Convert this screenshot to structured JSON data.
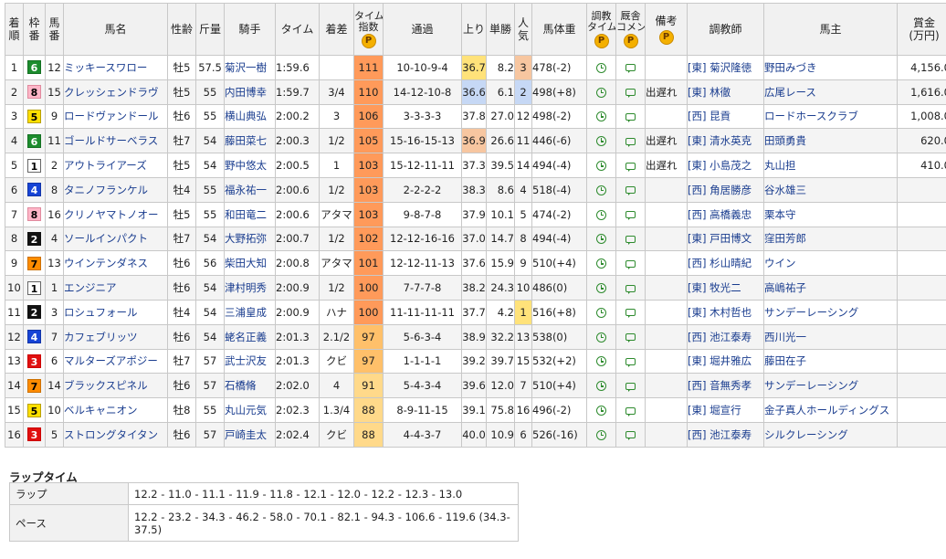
{
  "headers": {
    "rank": [
      "着",
      "順"
    ],
    "waku": [
      "枠",
      "番"
    ],
    "uma": [
      "馬",
      "番"
    ],
    "name": "馬名",
    "sexage": "性齢",
    "weight": "斤量",
    "jockey": "騎手",
    "time": "タイム",
    "margin": "着差",
    "index": [
      "タイム",
      "指数"
    ],
    "passing": "通過",
    "last3f": "上り",
    "odds": "単勝",
    "pop": [
      "人",
      "気"
    ],
    "bodyweight": "馬体重",
    "training": [
      "調教",
      "タイム"
    ],
    "stable_comment": [
      "厩舎",
      "コメント"
    ],
    "note": "備考",
    "trainer": "調教師",
    "owner": "馬主",
    "prize": [
      "賞金",
      "(万円)"
    ],
    "premium_badge": "P"
  },
  "colors": {
    "index_high": "#ff9a5a",
    "index_mid": "#ffc06a",
    "index_low": "#ffd98a",
    "last3f_1st": "#c6d8f5",
    "last3f_2nd": "#ffe27a",
    "last3f_3rd": "#f7c6a0",
    "pop_1": "#ffe27a",
    "pop_2": "#c6d8f5",
    "pop_3": "#f7c6a0",
    "icon": "#2e8b2e",
    "badge": "#f4b000"
  },
  "icons": {
    "training": "clock-icon",
    "comment": "speech-bubble-icon"
  },
  "rows": [
    {
      "rank": "1",
      "waku": "6",
      "uma": "12",
      "name": "ミッキースワロー",
      "sexage": "牡5",
      "weight": "57.5",
      "jockey": "菊沢一樹",
      "time": "1:59.6",
      "margin": "",
      "index": "111",
      "passing": "10-10-9-4",
      "last3f": "36.7",
      "odds": "8.2",
      "pop": "3",
      "bodyweight": "478(-2)",
      "note": "",
      "trainer": "[東] 菊沢隆徳",
      "owner": "野田みづき",
      "prize": "4,156.0"
    },
    {
      "rank": "2",
      "waku": "8",
      "uma": "15",
      "name": "クレッシェンドラヴ",
      "sexage": "牡5",
      "weight": "55",
      "jockey": "内田博幸",
      "time": "1:59.7",
      "margin": "3/4",
      "index": "110",
      "passing": "14-12-10-8",
      "last3f": "36.6",
      "odds": "6.1",
      "pop": "2",
      "bodyweight": "498(+8)",
      "note": "出遅れ",
      "trainer": "[東] 林徹",
      "owner": "広尾レース",
      "prize": "1,616.0"
    },
    {
      "rank": "3",
      "waku": "5",
      "uma": "9",
      "name": "ロードヴァンドール",
      "sexage": "牡6",
      "weight": "55",
      "jockey": "横山典弘",
      "time": "2:00.2",
      "margin": "3",
      "index": "106",
      "passing": "3-3-3-3",
      "last3f": "37.8",
      "odds": "27.0",
      "pop": "12",
      "bodyweight": "498(-2)",
      "note": "",
      "trainer": "[西] 昆貢",
      "owner": "ロードホースクラブ",
      "prize": "1,008.0"
    },
    {
      "rank": "4",
      "waku": "6",
      "uma": "11",
      "name": "ゴールドサーベラス",
      "sexage": "牡7",
      "weight": "54",
      "jockey": "藤田菜七",
      "time": "2:00.3",
      "margin": "1/2",
      "index": "105",
      "passing": "15-16-15-13",
      "last3f": "36.9",
      "odds": "26.6",
      "pop": "11",
      "bodyweight": "446(-6)",
      "note": "出遅れ",
      "trainer": "[東] 清水英克",
      "owner": "田頭勇貴",
      "prize": "620.0"
    },
    {
      "rank": "5",
      "waku": "1",
      "uma": "2",
      "name": "アウトライアーズ",
      "sexage": "牡5",
      "weight": "54",
      "jockey": "野中悠太",
      "time": "2:00.5",
      "margin": "1",
      "index": "103",
      "passing": "15-12-11-11",
      "last3f": "37.3",
      "odds": "39.5",
      "pop": "14",
      "bodyweight": "494(-4)",
      "note": "出遅れ",
      "trainer": "[東] 小島茂之",
      "owner": "丸山担",
      "prize": "410.0"
    },
    {
      "rank": "6",
      "waku": "4",
      "uma": "8",
      "name": "タニノフランケル",
      "sexage": "牡4",
      "weight": "55",
      "jockey": "福永祐一",
      "time": "2:00.6",
      "margin": "1/2",
      "index": "103",
      "passing": "2-2-2-2",
      "last3f": "38.3",
      "odds": "8.6",
      "pop": "4",
      "bodyweight": "518(-4)",
      "note": "",
      "trainer": "[西] 角居勝彦",
      "owner": "谷水雄三",
      "prize": ""
    },
    {
      "rank": "7",
      "waku": "8",
      "uma": "16",
      "name": "クリノヤマトノオー",
      "sexage": "牡5",
      "weight": "55",
      "jockey": "和田竜二",
      "time": "2:00.6",
      "margin": "アタマ",
      "index": "103",
      "passing": "9-8-7-8",
      "last3f": "37.9",
      "odds": "10.1",
      "pop": "5",
      "bodyweight": "474(-2)",
      "note": "",
      "trainer": "[西] 高橋義忠",
      "owner": "栗本守",
      "prize": ""
    },
    {
      "rank": "8",
      "waku": "2",
      "uma": "4",
      "name": "ソールインパクト",
      "sexage": "牡7",
      "weight": "54",
      "jockey": "大野拓弥",
      "time": "2:00.7",
      "margin": "1/2",
      "index": "102",
      "passing": "12-12-16-16",
      "last3f": "37.0",
      "odds": "14.7",
      "pop": "8",
      "bodyweight": "494(-4)",
      "note": "",
      "trainer": "[東] 戸田博文",
      "owner": "窪田芳郎",
      "prize": ""
    },
    {
      "rank": "9",
      "waku": "7",
      "uma": "13",
      "name": "ウインテンダネス",
      "sexage": "牡6",
      "weight": "56",
      "jockey": "柴田大知",
      "time": "2:00.8",
      "margin": "アタマ",
      "index": "101",
      "passing": "12-12-11-13",
      "last3f": "37.6",
      "odds": "15.9",
      "pop": "9",
      "bodyweight": "510(+4)",
      "note": "",
      "trainer": "[西] 杉山晴紀",
      "owner": "ウイン",
      "prize": ""
    },
    {
      "rank": "10",
      "waku": "1",
      "uma": "1",
      "name": "エンジニア",
      "sexage": "牡6",
      "weight": "54",
      "jockey": "津村明秀",
      "time": "2:00.9",
      "margin": "1/2",
      "index": "100",
      "passing": "7-7-7-8",
      "last3f": "38.2",
      "odds": "24.3",
      "pop": "10",
      "bodyweight": "486(0)",
      "note": "",
      "trainer": "[東] 牧光二",
      "owner": "高嶋祐子",
      "prize": ""
    },
    {
      "rank": "11",
      "waku": "2",
      "uma": "3",
      "name": "ロシュフォール",
      "sexage": "牡4",
      "weight": "54",
      "jockey": "三浦皇成",
      "time": "2:00.9",
      "margin": "ハナ",
      "index": "100",
      "passing": "11-11-11-11",
      "last3f": "37.7",
      "odds": "4.2",
      "pop": "1",
      "bodyweight": "516(+8)",
      "note": "",
      "trainer": "[東] 木村哲也",
      "owner": "サンデーレーシング",
      "prize": ""
    },
    {
      "rank": "12",
      "waku": "4",
      "uma": "7",
      "name": "カフェブリッツ",
      "sexage": "牡6",
      "weight": "54",
      "jockey": "蛯名正義",
      "time": "2:01.3",
      "margin": "2.1/2",
      "index": "97",
      "passing": "5-6-3-4",
      "last3f": "38.9",
      "odds": "32.2",
      "pop": "13",
      "bodyweight": "538(0)",
      "note": "",
      "trainer": "[西] 池江泰寿",
      "owner": "西川光一",
      "prize": ""
    },
    {
      "rank": "13",
      "waku": "3",
      "uma": "6",
      "name": "マルターズアポジー",
      "sexage": "牡7",
      "weight": "57",
      "jockey": "武士沢友",
      "time": "2:01.3",
      "margin": "クビ",
      "index": "97",
      "passing": "1-1-1-1",
      "last3f": "39.2",
      "odds": "39.7",
      "pop": "15",
      "bodyweight": "532(+2)",
      "note": "",
      "trainer": "[東] 堀井雅広",
      "owner": "藤田在子",
      "prize": ""
    },
    {
      "rank": "14",
      "waku": "7",
      "uma": "14",
      "name": "ブラックスピネル",
      "sexage": "牡6",
      "weight": "57",
      "jockey": "石橋脩",
      "time": "2:02.0",
      "margin": "4",
      "index": "91",
      "passing": "5-4-3-4",
      "last3f": "39.6",
      "odds": "12.0",
      "pop": "7",
      "bodyweight": "510(+4)",
      "note": "",
      "trainer": "[西] 音無秀孝",
      "owner": "サンデーレーシング",
      "prize": ""
    },
    {
      "rank": "15",
      "waku": "5",
      "uma": "10",
      "name": "ベルキャニオン",
      "sexage": "牡8",
      "weight": "55",
      "jockey": "丸山元気",
      "time": "2:02.3",
      "margin": "1.3/4",
      "index": "88",
      "passing": "8-9-11-15",
      "last3f": "39.1",
      "odds": "75.8",
      "pop": "16",
      "bodyweight": "496(-2)",
      "note": "",
      "trainer": "[東] 堀宣行",
      "owner": "金子真人ホールディングス",
      "prize": ""
    },
    {
      "rank": "16",
      "waku": "3",
      "uma": "5",
      "name": "ストロングタイタン",
      "sexage": "牡6",
      "weight": "57",
      "jockey": "戸崎圭太",
      "time": "2:02.4",
      "margin": "クビ",
      "index": "88",
      "passing": "4-4-3-7",
      "last3f": "40.0",
      "odds": "10.9",
      "pop": "6",
      "bodyweight": "526(-16)",
      "note": "",
      "trainer": "[西] 池江泰寿",
      "owner": "シルクレーシング",
      "prize": ""
    }
  ],
  "laps": {
    "title": "ラップタイム",
    "lap_label": "ラップ",
    "lap_values": "12.2 - 11.0 - 11.1 - 11.9 - 11.8 - 12.1 - 12.0 - 12.2 - 12.3 - 13.0",
    "pace_label": "ペース",
    "pace_values": "12.2 - 23.2 - 34.3 - 46.2 - 58.0 - 70.1 - 82.1 - 94.3 - 106.6 - 119.6 (34.3-37.5)"
  }
}
